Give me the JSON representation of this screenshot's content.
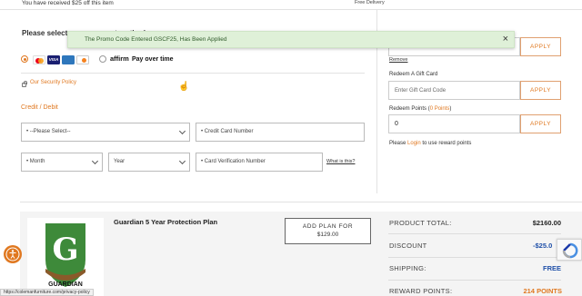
{
  "top": {
    "received_note": "You have received $25 off this item",
    "free_delivery": "Free Delivery"
  },
  "payment": {
    "section_title": "Please select your payment method",
    "affirm_label": "affirm",
    "pay_over_time": "Pay over time",
    "security_link": "Our Security Policy",
    "credit_debit": "Credit / Debit",
    "select_placeholder": "--Please Select--",
    "card_number_placeholder": "Credit Card Number",
    "month_label": "Month",
    "year_label": "Year",
    "cvv_placeholder": "Card Verification Number",
    "what_is_this": "What is this?",
    "selected_method": "credit-card"
  },
  "toast": {
    "message": "The Promo Code Entered GSCF25, Has Been Applied",
    "close": "×"
  },
  "promo": {
    "value": "GSCF25",
    "apply": "APPLY",
    "remove": "Remove"
  },
  "gift_card": {
    "label": "Redeem A Gift Card",
    "placeholder": "Enter Gift Card Code",
    "apply": "APPLY"
  },
  "points": {
    "label_prefix": "Redeem Points (",
    "label_count": "0 Points",
    "label_suffix": ")",
    "value": "0",
    "apply": "APPLY",
    "note_prefix": "Please ",
    "login": "Login",
    "note_suffix": " to use reward points"
  },
  "plan": {
    "title": "Guardian 5 Year Protection Plan",
    "add_line1": "ADD PLAN FOR",
    "add_line2": "$129.00",
    "brand": "GUARDIAN"
  },
  "summary": {
    "product_total_label": "PRODUCT TOTAL:",
    "product_total": "$2160.00",
    "discount_label": "DISCOUNT",
    "discount": "-$25.0",
    "shipping_label": "SHIPPING:",
    "shipping": "FREE",
    "reward_label": "REWARD POINTS:",
    "reward": "214 POINTS"
  },
  "status_url": "https://colemanfurniture.com/privacy-policy",
  "colors": {
    "accent": "#e07820",
    "toast_bg": "#dff0d8",
    "guardian_green": "#3e8a3a",
    "discount_blue": "#1f4fa8"
  }
}
